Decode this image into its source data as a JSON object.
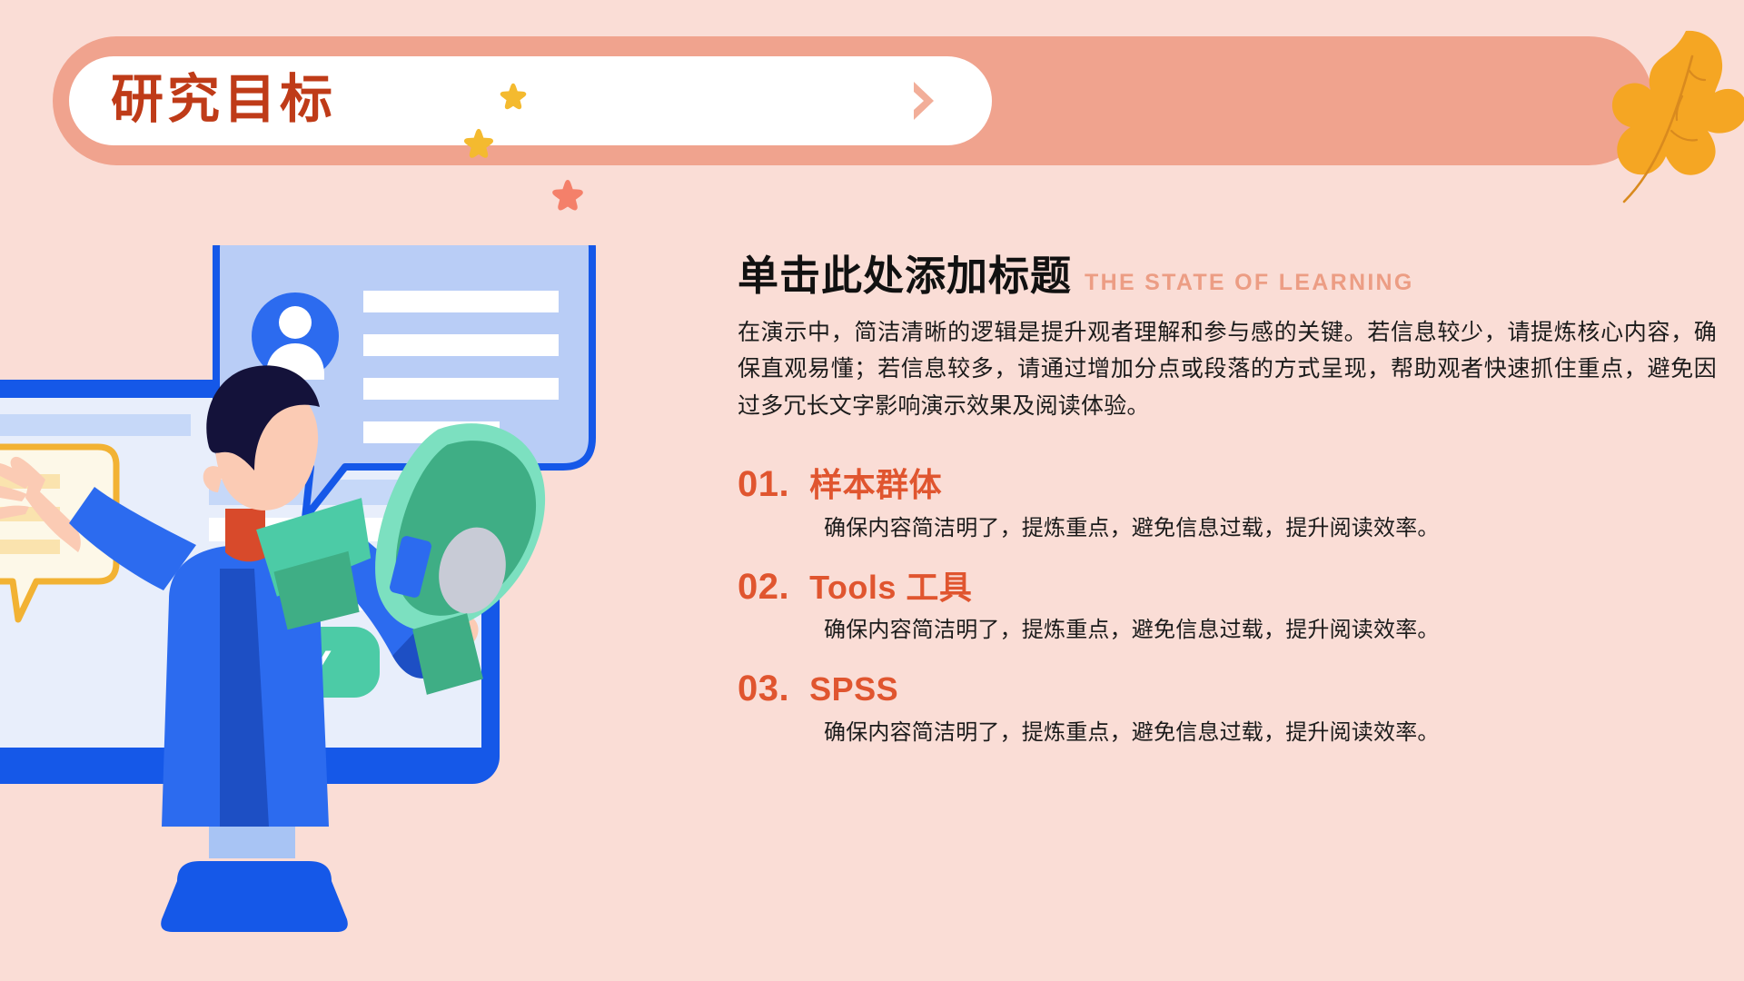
{
  "slide": {
    "background_color": "#FADDD6"
  },
  "banner": {
    "title": "研究目标",
    "title_color": "#BF3B18",
    "band_color": "#F0A38E",
    "pill_color": "#FFFFFF",
    "chevron_icon": "chevron-right-icon",
    "chevron_color": "#F2AE99"
  },
  "decorations": {
    "leaf_icon": "oak-leaf-icon",
    "leaf_color": "#F5A623",
    "stars": [
      {
        "name": "star-yellow-top",
        "color": "#F4BA2F"
      },
      {
        "name": "star-yellow-mid",
        "color": "#F4BA2F"
      },
      {
        "name": "star-coral",
        "color": "#F4806A"
      }
    ]
  },
  "illustration": {
    "name": "monitor-presenter-megaphone-illustration",
    "monitor_frame_color": "#1558E8",
    "screen_color": "#E8EEFB",
    "buy_button_label": "BUY",
    "buy_button_color": "#4CCBA6",
    "megaphone_color": "#45BF92",
    "shirt_color": "#2C6BEF",
    "hair_color": "#14123A",
    "speech_card_color": "#B9CDF6",
    "yellow_bubble_color": "#FDF8E8"
  },
  "content": {
    "heading_cn": "单击此处添加标题",
    "heading_en": "THE STATE OF LEARNING",
    "heading_cn_color": "#111111",
    "heading_en_color": "#EC9D84",
    "paragraph": "在演示中，简洁清晰的逻辑是提升观者理解和参与感的关键。若信息较少，请提炼核心内容，确保直观易懂；若信息较多，请通过增加分点或段落的方式呈现，帮助观者快速抓住重点，避免因过多冗长文字影响演示效果及阅读体验。",
    "accent_color": "#E0552F",
    "items": [
      {
        "number": "01.",
        "title": "样本群体",
        "desc": "确保内容简洁明了，提炼重点，避免信息过载，提升阅读效率。"
      },
      {
        "number": "02.",
        "title": "Tools 工具",
        "desc": "确保内容简洁明了，提炼重点，避免信息过载，提升阅读效率。"
      },
      {
        "number": "03.",
        "title": "SPSS",
        "desc": "确保内容简洁明了，提炼重点，避免信息过载，提升阅读效率。"
      }
    ]
  }
}
